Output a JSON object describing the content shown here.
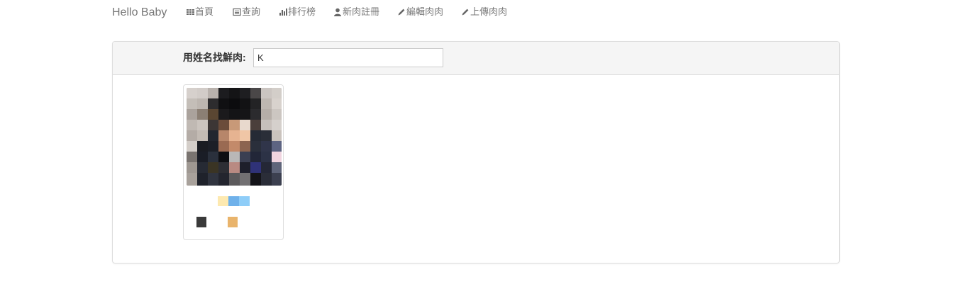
{
  "navbar": {
    "brand": "Hello Baby",
    "items": [
      {
        "label": "首頁",
        "icon": "th-grid-icon"
      },
      {
        "label": "查詢",
        "icon": "list-alt-icon"
      },
      {
        "label": "排行榜",
        "icon": "bar-chart-icon"
      },
      {
        "label": "新肉註冊",
        "icon": "user-icon"
      },
      {
        "label": "編輯肉肉",
        "icon": "pencil-icon"
      },
      {
        "label": "上傳肉肉",
        "icon": "pencil-icon"
      }
    ]
  },
  "search": {
    "label": "用姓名找鮮肉:",
    "value": "K"
  },
  "colors": {
    "nav_text": "#777777",
    "panel_heading_bg": "#f5f5f5",
    "border": "#dddddd",
    "caption_swatches": [
      "#fde9b0",
      "#6fb1ea",
      "#8ecdf8"
    ],
    "meta_swatches": [
      "#3a3a3a",
      "#e9b46c"
    ]
  }
}
